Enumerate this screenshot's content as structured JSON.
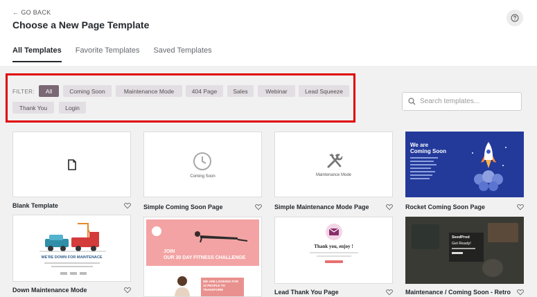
{
  "header": {
    "go_back": "GO BACK",
    "title": "Choose a New Page Template",
    "tabs": [
      {
        "label": "All Templates",
        "active": true
      },
      {
        "label": "Favorite Templates",
        "active": false
      },
      {
        "label": "Saved Templates",
        "active": false
      }
    ]
  },
  "filter": {
    "label": "FILTER:",
    "chips": [
      "All",
      "Coming Soon",
      "Maintenance Mode",
      "404 Page",
      "Sales",
      "Webinar",
      "Lead Squeeze",
      "Thank You",
      "Login"
    ],
    "active": "All"
  },
  "search": {
    "placeholder": "Search templates..."
  },
  "templates": [
    {
      "label": "Blank Template"
    },
    {
      "label": "Simple Coming Soon Page",
      "thumb_text": "Coming Soon"
    },
    {
      "label": "Simple Maintenance Mode Page",
      "thumb_text": "Maintenance Mode"
    },
    {
      "label": "Rocket Coming Soon Page",
      "thumb_text_1": "We are",
      "thumb_text_2": "Coming Soon"
    },
    {
      "label": "Down Maintenance Mode",
      "thumb_text": "WE'RE DOWN FOR MAINTENACE"
    },
    {
      "label": "",
      "thumb_text_1": "JOIN",
      "thumb_text_2": "OUR 30 DAY FITNESS CHALLENGE",
      "thumb_text_3": "WE ARE LOOKING FOR",
      "thumb_text_4": "10 PEOPLE TO TRANSFORM"
    },
    {
      "label": "Lead Thank You Page",
      "thumb_text": "Thank you, enjoy !"
    },
    {
      "label": "Maintenance / Coming Soon - Retro",
      "thumb_text_1": "SeedProd",
      "thumb_text_2": "Get Ready!"
    }
  ],
  "colors": {
    "accent": "#7a6875",
    "highlight_border": "#e00000",
    "rocket_bg": "#233a9a",
    "fitness_pink": "#f09a9a"
  }
}
